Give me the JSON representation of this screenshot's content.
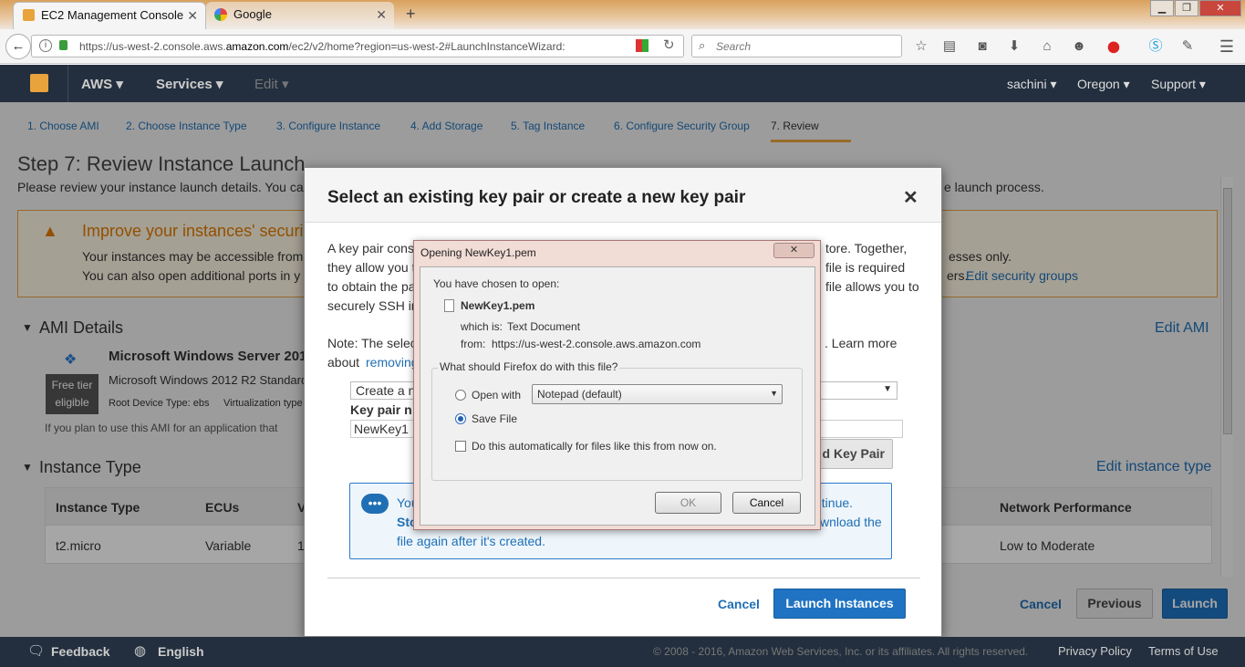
{
  "browser": {
    "tabs": [
      {
        "title": "EC2 Management Console"
      },
      {
        "title": "Google"
      }
    ],
    "url_prefix": "https://us-west-2.console.aws.",
    "url_domain": "amazon.com",
    "url_suffix": "/ec2/v2/home?region=us-west-2#LaunchInstanceWizard:",
    "search_placeholder": "Search"
  },
  "aws_header": {
    "aws": "AWS",
    "services": "Services",
    "edit": "Edit",
    "user": "sachini",
    "region": "Oregon",
    "support": "Support"
  },
  "wizard_steps": [
    "1. Choose AMI",
    "2. Choose Instance Type",
    "3. Configure Instance",
    "4. Add Storage",
    "5. Tag Instance",
    "6. Configure Security Group",
    "7. Review"
  ],
  "page": {
    "title": "Step 7: Review Instance Launch",
    "intro": "Please review your instance launch details. You ca",
    "intro_tail": "e launch process.",
    "warn_title": "Improve your instances' securi",
    "warn_line1": "Your instances may be accessible from",
    "warn_line1_tail": "esses only.",
    "warn_line2": "You can also open additional ports in y",
    "warn_line2_tail": "ers.",
    "edit_sg": "Edit security groups",
    "ami_section": "AMI Details",
    "edit_ami": "Edit AMI",
    "ami_name": "Microsoft Windows Server 201",
    "ami_desc": "Microsoft Windows 2012 R2 Standard",
    "ami_meta1": "Root Device Type: ebs",
    "ami_meta2": "Virtualization type",
    "free_tier_1": "Free tier",
    "free_tier_2": "eligible",
    "ami_note": "If you plan to use this AMI for an application that",
    "instance_section": "Instance Type",
    "edit_instance": "Edit instance type",
    "table_headers": [
      "Instance Type",
      "ECUs",
      "V",
      "Network Performance"
    ],
    "table_row": [
      "t2.micro",
      "Variable",
      "1",
      "Low to Moderate"
    ],
    "cancel": "Cancel",
    "previous": "Previous",
    "launch": "Launch"
  },
  "modal": {
    "title": "Select an existing key pair or create a new key pair",
    "p1": [
      "A key pair cons",
      "tore. Together,",
      "they allow you t",
      "file is required",
      "to obtain the pa",
      "file allows you to",
      "securely SSH in"
    ],
    "note": "Note: The selec",
    "note_tail": ". Learn more",
    "about": "about",
    "removing": "removing",
    "select_value": "Create a n",
    "kp_label": "Key pair n",
    "kp_value": "NewKey1",
    "download_btn": "d Key Pair",
    "info1": "You",
    "info1_tail": "ntinue.",
    "info2": "Sto",
    "info2_tail": "wnload the",
    "info3": "file again after it's created.",
    "cancel": "Cancel",
    "launch": "Launch Instances"
  },
  "file_dialog": {
    "title": "Opening NewKey1.pem",
    "chosen": "You have chosen to open:",
    "filename": "NewKey1.pem",
    "which_label": "which is:",
    "which_value": "Text Document",
    "from_label": "from:",
    "from_value": "https://us-west-2.console.aws.amazon.com",
    "question": "What should Firefox do with this file?",
    "open_with": "Open with",
    "app": "Notepad (default)",
    "save_file": "Save File",
    "auto": "Do this automatically for files like this from now on.",
    "ok": "OK",
    "cancel": "Cancel"
  },
  "footer": {
    "feedback": "Feedback",
    "english": "English",
    "copyright": "© 2008 - 2016, Amazon Web Services, Inc. or its affiliates. All rights reserved.",
    "privacy": "Privacy Policy",
    "terms": "Terms of Use"
  }
}
